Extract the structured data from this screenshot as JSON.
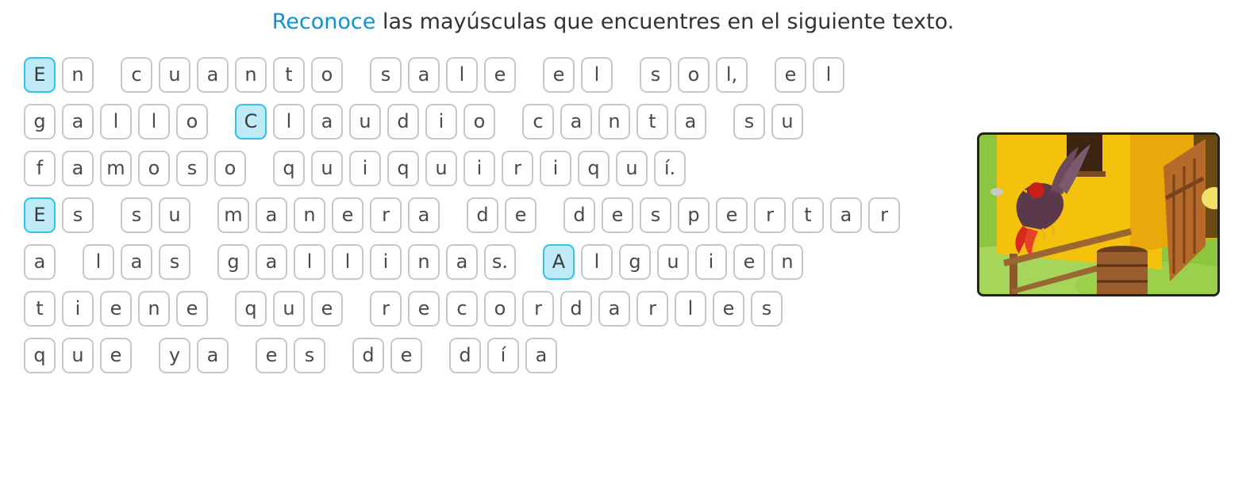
{
  "instruction": {
    "keyword": "Reconoce",
    "rest": " las mayúsculas que encuentres en el siguiente texto."
  },
  "highlight_color": "#bfeaf8",
  "highlight_border": "#2fc3ea",
  "lines": [
    [
      "En",
      "cuanto",
      "sale",
      "el",
      "sol,",
      "el"
    ],
    [
      "gallo",
      "Claudio",
      "canta",
      "su"
    ],
    [
      "famoso",
      "quiquiriquí."
    ],
    [
      "Es",
      "su",
      "manera",
      "de",
      "despertar"
    ],
    [
      "a",
      "las",
      "gallinas.",
      "Alguien"
    ],
    [
      "tiene",
      "que",
      "recordarles"
    ],
    [
      "que",
      "ya",
      "es",
      "de",
      "día"
    ]
  ],
  "tiles": [
    [
      [
        "E",
        "n"
      ],
      [
        "c",
        "u",
        "a",
        "n",
        "t",
        "o"
      ],
      [
        "s",
        "a",
        "l",
        "e"
      ],
      [
        "e",
        "l"
      ],
      [
        "s",
        "o",
        "l,"
      ],
      [
        "e",
        "l"
      ]
    ],
    [
      [
        "g",
        "a",
        "l",
        "l",
        "o"
      ],
      [
        "C",
        "l",
        "a",
        "u",
        "d",
        "i",
        "o"
      ],
      [
        "c",
        "a",
        "n",
        "t",
        "a"
      ],
      [
        "s",
        "u"
      ]
    ],
    [
      [
        "f",
        "a",
        "m",
        "o",
        "s",
        "o"
      ],
      [
        "q",
        "u",
        "i",
        "q",
        "u",
        "i",
        "r",
        "i",
        "q",
        "u",
        "í."
      ]
    ],
    [
      [
        "E",
        "s"
      ],
      [
        "s",
        "u"
      ],
      [
        "m",
        "a",
        "n",
        "e",
        "r",
        "a"
      ],
      [
        "d",
        "e"
      ],
      [
        "d",
        "e",
        "s",
        "p",
        "e",
        "r",
        "t",
        "a",
        "r"
      ]
    ],
    [
      [
        "a"
      ],
      [
        "l",
        "a",
        "s"
      ],
      [
        "g",
        "a",
        "l",
        "l",
        "i",
        "n",
        "a",
        "s."
      ],
      [
        "A",
        "l",
        "g",
        "u",
        "i",
        "e",
        "n"
      ]
    ],
    [
      [
        "t",
        "i",
        "e",
        "n",
        "e"
      ],
      [
        "q",
        "u",
        "e"
      ],
      [
        "r",
        "e",
        "c",
        "o",
        "r",
        "d",
        "a",
        "r",
        "l",
        "e",
        "s"
      ]
    ],
    [
      [
        "q",
        "u",
        "e"
      ],
      [
        "y",
        "a"
      ],
      [
        "e",
        "s"
      ],
      [
        "d",
        "e"
      ],
      [
        "d",
        "í",
        "a"
      ]
    ]
  ],
  "selected": [
    "0-0-0",
    "1-1-0",
    "3-0-0",
    "4-3-0"
  ],
  "illustration": "rooster-on-fence-barn-illustration"
}
